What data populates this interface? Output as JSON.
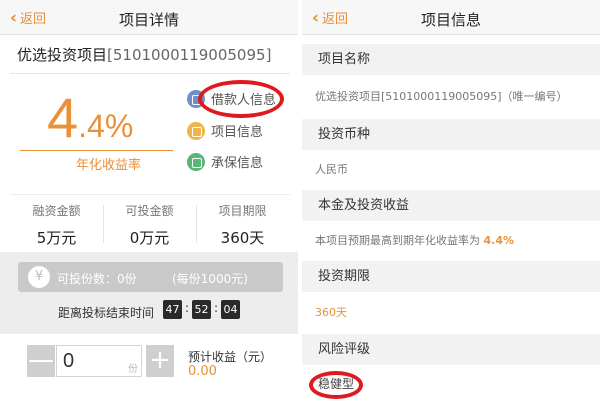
{
  "left": {
    "nav": {
      "back": "返回",
      "title": "项目详情"
    },
    "project_name": "优选投资项目",
    "project_code": "[5101000119005095]",
    "rate": {
      "big": "4",
      "small": ".4%",
      "label": "年化收益率"
    },
    "side_links": [
      "借款人信息",
      "项目信息",
      "承保信息"
    ],
    "stats": [
      {
        "label": "融资金额",
        "value": "5万元"
      },
      {
        "label": "可投金额",
        "value": "0万元"
      },
      {
        "label": "项目期限",
        "value": "360天"
      }
    ],
    "available": "可投份数：0份",
    "per_share": "(每份1000元)",
    "countdown_label": "距离投标结束时间",
    "countdown": [
      "47",
      "52",
      "04"
    ],
    "quantity": "0",
    "unit": "份",
    "minus": "—",
    "plus": "+",
    "yen": "¥",
    "estimate_label": "预计收益（元）",
    "estimate_value": "0.00"
  },
  "right": {
    "nav": {
      "back": "返回",
      "title": "项目信息"
    },
    "rows": {
      "name_label": "项目名称",
      "name_value": "优选投资项目[5101000119005095]（唯一编号）",
      "currency_label": "投资币种",
      "currency_value": "人民币",
      "return_label": "本金及投资收益",
      "return_value_prefix": "本项目预期最高到期年化收益率为",
      "return_value_rate": "4.4%",
      "term_label": "投资期限",
      "term_value": "360天",
      "risk_label": "风险评级",
      "risk_value": "稳健型"
    }
  },
  "colors": {
    "accent": "#e8913a",
    "highlight_ring": "#e0191e"
  }
}
